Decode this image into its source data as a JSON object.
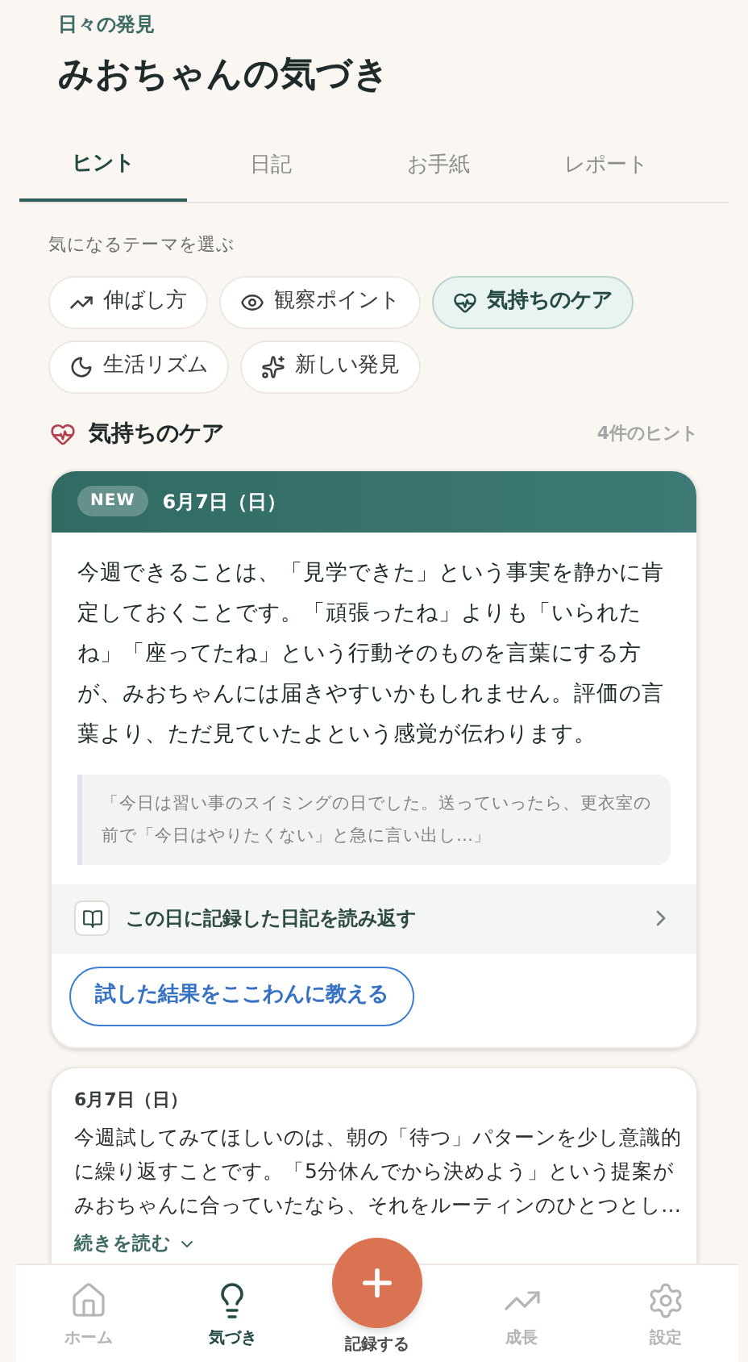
{
  "header": {
    "eyebrow": "日々の発見",
    "title": "みおちゃんの気づき"
  },
  "tabs": [
    {
      "label": "ヒント",
      "selected": true
    },
    {
      "label": "日記",
      "selected": false
    },
    {
      "label": "お手紙",
      "selected": false
    },
    {
      "label": "レポート",
      "selected": false
    }
  ],
  "themes": {
    "label": "気になるテーマを選ぶ",
    "chips": [
      {
        "kind": "growth",
        "label": "伸ばし方",
        "selected": false
      },
      {
        "kind": "eye",
        "label": "観察ポイント",
        "selected": false
      },
      {
        "kind": "heart",
        "label": "気持ちのケア",
        "selected": true
      },
      {
        "kind": "moon",
        "label": "生活リズム",
        "selected": false
      },
      {
        "kind": "sparkle",
        "label": "新しい発見",
        "selected": false
      }
    ]
  },
  "section": {
    "title": "気持ちのケア",
    "count": "4件のヒント"
  },
  "cards": [
    {
      "featured": true,
      "badge": "NEW",
      "date": "6月7日（日）",
      "body": "今週できることは、「見学できた」という事実を静かに肯定しておくことです。「頑張ったね」よりも「いられたね」「座ってたね」という行動そのものを言葉にする方が、みおちゃんには届きやすいかもしれません。評価の言葉より、ただ見ていたよという感覚が伝わります。",
      "quote": "「今日は習い事のスイミングの日でした。送っていったら、更衣室の前で「今日はやりたくない」と急に言い出し…」",
      "diary_link": "この日に記録した日記を読み返す",
      "action": "試した結果をここわんに教える"
    },
    {
      "featured": false,
      "date": "6月7日（日）",
      "body": "今週試してみてほしいのは、朝の「待つ」パターンを少し意識的に繰り返すことです。「5分休んでから決めよう」という提案がみおちゃんに合っていたなら、それをルーティンのひとつとし…",
      "more": "続きを読む"
    }
  ],
  "nav": [
    {
      "kind": "home",
      "label": "ホーム",
      "selected": false
    },
    {
      "kind": "bulb",
      "label": "気づき",
      "selected": true
    },
    {
      "kind": "add",
      "label": "記録する",
      "selected": false
    },
    {
      "kind": "growth",
      "label": "成長",
      "selected": false
    },
    {
      "kind": "settings",
      "label": "設定",
      "selected": false
    }
  ]
}
